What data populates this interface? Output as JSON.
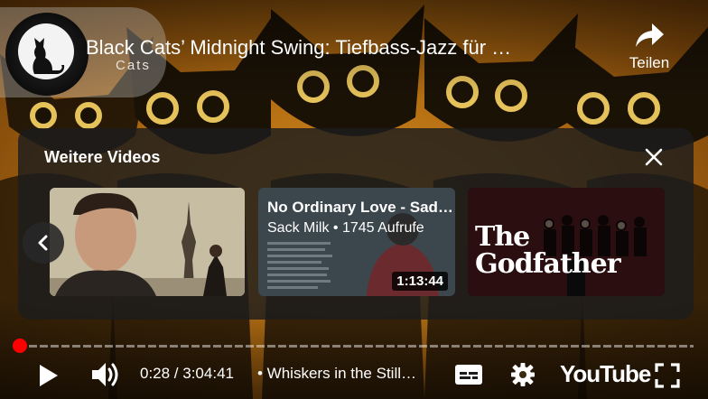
{
  "video": {
    "title": "Black Cats’ Midnight Swing: Tiefbass-Jazz für …",
    "channel_name": "Cats",
    "share_label": "Teilen"
  },
  "more_videos": {
    "heading": "Weitere Videos",
    "items": [
      {
        "title": "",
        "meta": "",
        "duration": ""
      },
      {
        "title": "No Ordinary Love - Sad…",
        "meta": "Sack Milk • 1745 Aufrufe",
        "duration": "1:13:44"
      },
      {
        "title": "",
        "meta": "",
        "duration": "",
        "poster_text": "The Godfather"
      }
    ]
  },
  "player": {
    "current_time": "0:28",
    "duration": "3:04:41",
    "time_display": "0:28 / 3:04:41",
    "chapter": "• Whiskers in the Still…",
    "progress_fraction": 0.0025,
    "logo": "YouTube",
    "accent_color": "#ff0000"
  },
  "icons": [
    "share-icon",
    "close-icon",
    "chevron-left-icon",
    "play-icon",
    "volume-icon",
    "subtitles-icon",
    "settings-icon",
    "fullscreen-icon"
  ]
}
